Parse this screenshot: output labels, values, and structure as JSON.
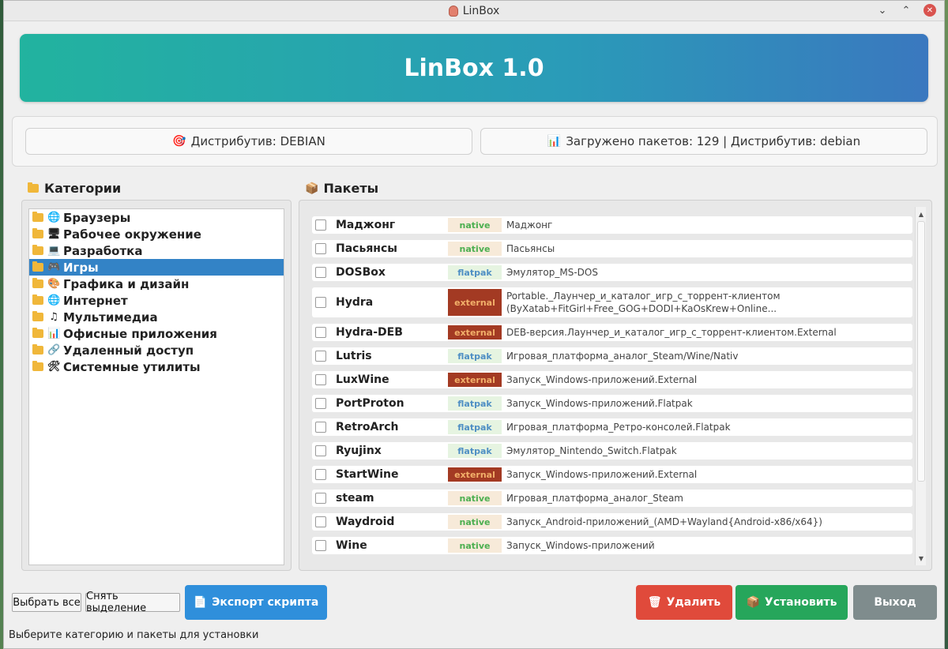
{
  "window": {
    "title": "LinBox",
    "controls": [
      "minimize",
      "maximize",
      "close"
    ]
  },
  "banner": {
    "title": "LinBox 1.0"
  },
  "info": {
    "distro_label": "Дистрибутив: DEBIAN",
    "distro_icon": "target-icon",
    "packages_label": "Загружено пакетов: 129 | Дистрибутив: debian",
    "packages_icon": "chart-icon"
  },
  "categories": {
    "title": "Категории",
    "items": [
      {
        "label": "Браузеры",
        "icon": "🌐"
      },
      {
        "label": "Рабочее окружение",
        "icon": "🖥"
      },
      {
        "label": "Разработка",
        "icon": "💻"
      },
      {
        "label": "Игры",
        "icon": "🎮",
        "selected": true
      },
      {
        "label": "Графика и дизайн",
        "icon": "🎨"
      },
      {
        "label": "Интернет",
        "icon": "🌐"
      },
      {
        "label": "Мультимедиа",
        "icon": "♫"
      },
      {
        "label": "Офисные приложения",
        "icon": "📊"
      },
      {
        "label": "Удаленный доступ",
        "icon": "🔗"
      },
      {
        "label": "Системные утилиты",
        "icon": "🛠"
      }
    ]
  },
  "packages": {
    "title": "Пакеты",
    "items": [
      {
        "name": "Маджонг",
        "type": "native",
        "desc": "Маджонг"
      },
      {
        "name": "Пасьянсы",
        "type": "native",
        "desc": "Пасьянсы"
      },
      {
        "name": "DOSBox",
        "type": "flatpak",
        "desc": "Эмулятор_MS-DOS"
      },
      {
        "name": "Hydra",
        "type": "external",
        "desc": "Portable._Лаунчер_и_каталог_игр_с_торрент-клиентом (ByXatab+FitGirl+Free_GOG+DODI+KaOsKrew+Online..."
      },
      {
        "name": "Hydra-DEB",
        "type": "external",
        "desc": "DEB-версия.Лаунчер_и_каталог_игр_с_торрент-клиентом.External"
      },
      {
        "name": "Lutris",
        "type": "flatpak",
        "desc": "Игровая_платформа_аналог_Steam/Wine/Nativ"
      },
      {
        "name": "LuxWine",
        "type": "external",
        "desc": "Запуск_Windows-приложений.External"
      },
      {
        "name": "PortProton",
        "type": "flatpak",
        "desc": "Запуск_Windows-приложений.Flatpak"
      },
      {
        "name": "RetroArch",
        "type": "flatpak",
        "desc": "Игровая_платформа_Ретро-консолей.Flatpak"
      },
      {
        "name": "Ryujinx",
        "type": "flatpak",
        "desc": "Эмулятор_Nintendo_Switch.Flatpak"
      },
      {
        "name": "StartWine",
        "type": "external",
        "desc": "Запуск_Windows-приложений.External"
      },
      {
        "name": "steam",
        "type": "native",
        "desc": "Игровая_платформа_аналог_Steam"
      },
      {
        "name": "Waydroid",
        "type": "native",
        "desc": "Запуск_Android-приложений_(AMD+Wayland{Android-x86/x64})"
      },
      {
        "name": "Wine",
        "type": "native",
        "desc": "Запуск_Windows-приложений"
      }
    ]
  },
  "buttons": {
    "select_all": "Выбрать все",
    "deselect": "Снять выделение",
    "export": "Экспорт скрипта",
    "delete": "Удалить",
    "install": "Установить",
    "exit": "Выход"
  },
  "status": "Выберите категорию и пакеты для установки",
  "colors": {
    "banner_start": "#22b39f",
    "banner_end": "#3a78bf",
    "selected": "#3383c6",
    "export": "#2f8fdb",
    "delete": "#e04a3b",
    "install": "#26a65b",
    "exit": "#7f8c8d"
  }
}
